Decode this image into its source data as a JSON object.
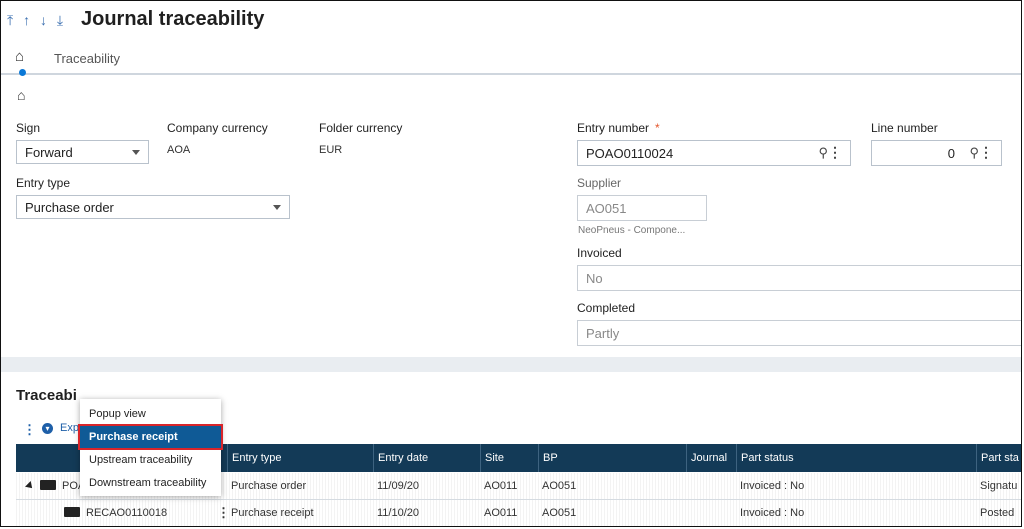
{
  "header": {
    "nav_arrows": "⤒ ↑ ↓ ⤓",
    "title": "Journal traceability"
  },
  "tabs": {
    "home_icon": "home-icon",
    "traceability": "Traceability"
  },
  "form": {
    "sign": {
      "label": "Sign",
      "value": "Forward"
    },
    "company_currency": {
      "label": "Company currency",
      "value": "AOA"
    },
    "folder_currency": {
      "label": "Folder currency",
      "value": "EUR"
    },
    "entry_type": {
      "label": "Entry type",
      "value": "Purchase order"
    },
    "entry_number": {
      "label": "Entry number",
      "required_mark": "*",
      "value": "POAO0110024"
    },
    "line_number": {
      "label": "Line number",
      "value": "0"
    },
    "supplier": {
      "label": "Supplier",
      "value": "AO051",
      "description": "NeoPneus - Compone..."
    },
    "invoiced": {
      "label": "Invoiced",
      "value": "No"
    },
    "completed": {
      "label": "Completed",
      "value": "Partly"
    }
  },
  "traceability": {
    "title": "Traceabi",
    "expand_label": "Exp",
    "columns": [
      "",
      "Entry type",
      "Entry date",
      "Site",
      "BP",
      "Journal",
      "Part status",
      "Part sta"
    ],
    "rows": [
      {
        "entry": "POA",
        "entry_type": "Purchase order",
        "entry_date": "11/09/20",
        "site": "AO011",
        "bp": "AO051",
        "journal": "",
        "part_status": "Invoiced : No",
        "part_status2": "Signatu"
      },
      {
        "entry": "RECAO0110018",
        "entry_type": "Purchase receipt",
        "entry_date": "11/10/20",
        "site": "AO011",
        "bp": "AO051",
        "journal": "",
        "part_status": "Invoiced : No",
        "part_status2": "Posted"
      }
    ]
  },
  "context_menu": {
    "items": [
      "Popup view",
      "Purchase receipt",
      "Upstream traceability",
      "Downstream traceability"
    ],
    "selected": "Purchase receipt"
  },
  "colors": {
    "accent": "#0a78d7",
    "grid_header": "#133a57",
    "menu_selected": "#0f5a96",
    "highlight_border": "#d9252a",
    "required": "#e4572e"
  }
}
